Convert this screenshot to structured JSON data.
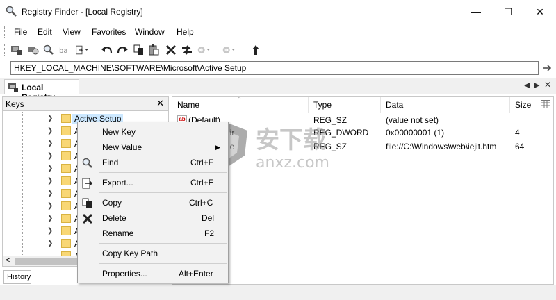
{
  "window": {
    "title": "Registry Finder - [Local Registry]",
    "minimize_glyph": "—",
    "maximize_glyph": "☐",
    "close_glyph": "✕"
  },
  "menu": [
    "File",
    "Edit",
    "View",
    "Favorites",
    "Window",
    "Help"
  ],
  "toolbar_icons": [
    "computer-icon",
    "connect-icon",
    "find-icon",
    "replace-icon",
    "export-icon",
    "undo-icon",
    "redo-icon",
    "copy-icon",
    "paste-icon",
    "delete-icon",
    "rename-icon",
    "back-icon",
    "forward-icon",
    "up-icon"
  ],
  "address": {
    "path": "HKEY_LOCAL_MACHINE\\SOFTWARE\\Microsoft\\Active Setup"
  },
  "tab": {
    "label": "Local Registry",
    "nav_left": "◀",
    "nav_right": "▶",
    "close": "✕"
  },
  "keys_pane": {
    "title": "Keys",
    "close": "✕",
    "selected": "Active Setup",
    "rows": [
      "Active Setup",
      "A",
      "A",
      "A",
      "A",
      "A",
      "A",
      "A",
      "A",
      "A",
      "A",
      "A"
    ],
    "scroll_left": "<"
  },
  "list": {
    "columns": [
      "Name",
      "Type",
      "Data",
      "Size"
    ],
    "rows": [
      {
        "name": "(Default)",
        "type": "REG_SZ",
        "data": "(value not set)",
        "size": ""
      },
      {
        "name": "air",
        "type": "REG_DWORD",
        "data": "0x00000001 (1)",
        "size": "4"
      },
      {
        "name": "ge",
        "type": "REG_SZ",
        "data": "file://C:\\Windows\\web\\iejit.htm",
        "size": "64"
      }
    ]
  },
  "history": {
    "label": "History"
  },
  "context_menu": {
    "items": [
      {
        "label": "New Key",
        "shortcut": ""
      },
      {
        "label": "New Value",
        "shortcut": "▶"
      },
      {
        "label": "Find",
        "shortcut": "Ctrl+F"
      },
      {
        "label": "Export...",
        "shortcut": "Ctrl+E"
      },
      {
        "label": "Copy",
        "shortcut": "Ctrl+C"
      },
      {
        "label": "Delete",
        "shortcut": "Del"
      },
      {
        "label": "Rename",
        "shortcut": "F2"
      },
      {
        "label": "Copy Key Path",
        "shortcut": ""
      },
      {
        "label": "Properties...",
        "shortcut": "Alt+Enter"
      }
    ]
  },
  "watermark": {
    "cn": "安下载",
    "url": "anxz.com"
  }
}
